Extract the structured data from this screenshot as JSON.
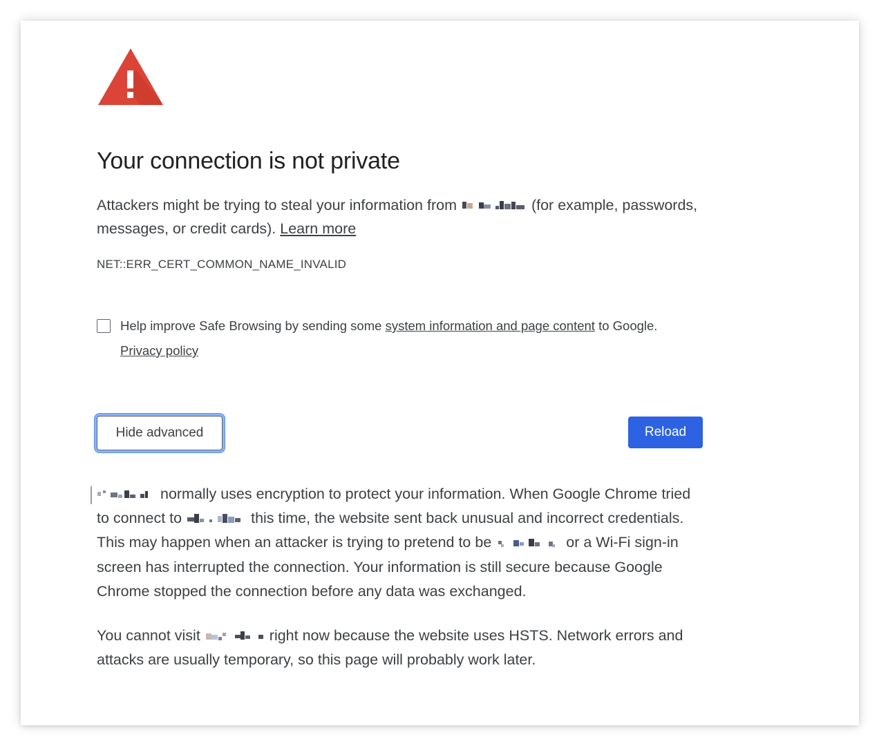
{
  "page": {
    "title": "Your connection is not private",
    "intro_before": "Attackers might be trying to steal your information from",
    "intro_after": "(for example, passwords, messages, or credit cards).",
    "learn_more": "Learn more",
    "error_code": "NET::ERR_CERT_COMMON_NAME_INVALID"
  },
  "safe_browsing": {
    "checked": false,
    "text_before": "Help improve Safe Browsing by sending some",
    "link_system_info": "system information and page content",
    "text_after": "to Google.",
    "privacy_link": "Privacy policy"
  },
  "buttons": {
    "hide_advanced": "Hide advanced",
    "reload": "Reload"
  },
  "details": {
    "p1_a": "normally uses encryption to protect your information. When Google Chrome tried to connect to",
    "p1_b": "this time, the website sent back unusual and incorrect credentials. This may happen when an attacker is trying to pretend to be",
    "p1_c": "or a Wi-Fi sign-in screen has interrupted the connection. Your information is still secure because Google Chrome stopped the connection before any data was exchanged.",
    "p2_a": "You cannot visit",
    "p2_b": "right now because the website uses HSTS. Network errors and attacks are usually temporary, so this page will probably work later."
  },
  "colors": {
    "warning_red": "#db4437",
    "primary_blue": "#2d63e2",
    "focus_ring": "#8ab4f8",
    "text": "#3c4043",
    "title": "#202124"
  },
  "icons": {
    "warning": "warning-triangle-icon",
    "checkbox": "checkbox-unchecked-icon"
  }
}
